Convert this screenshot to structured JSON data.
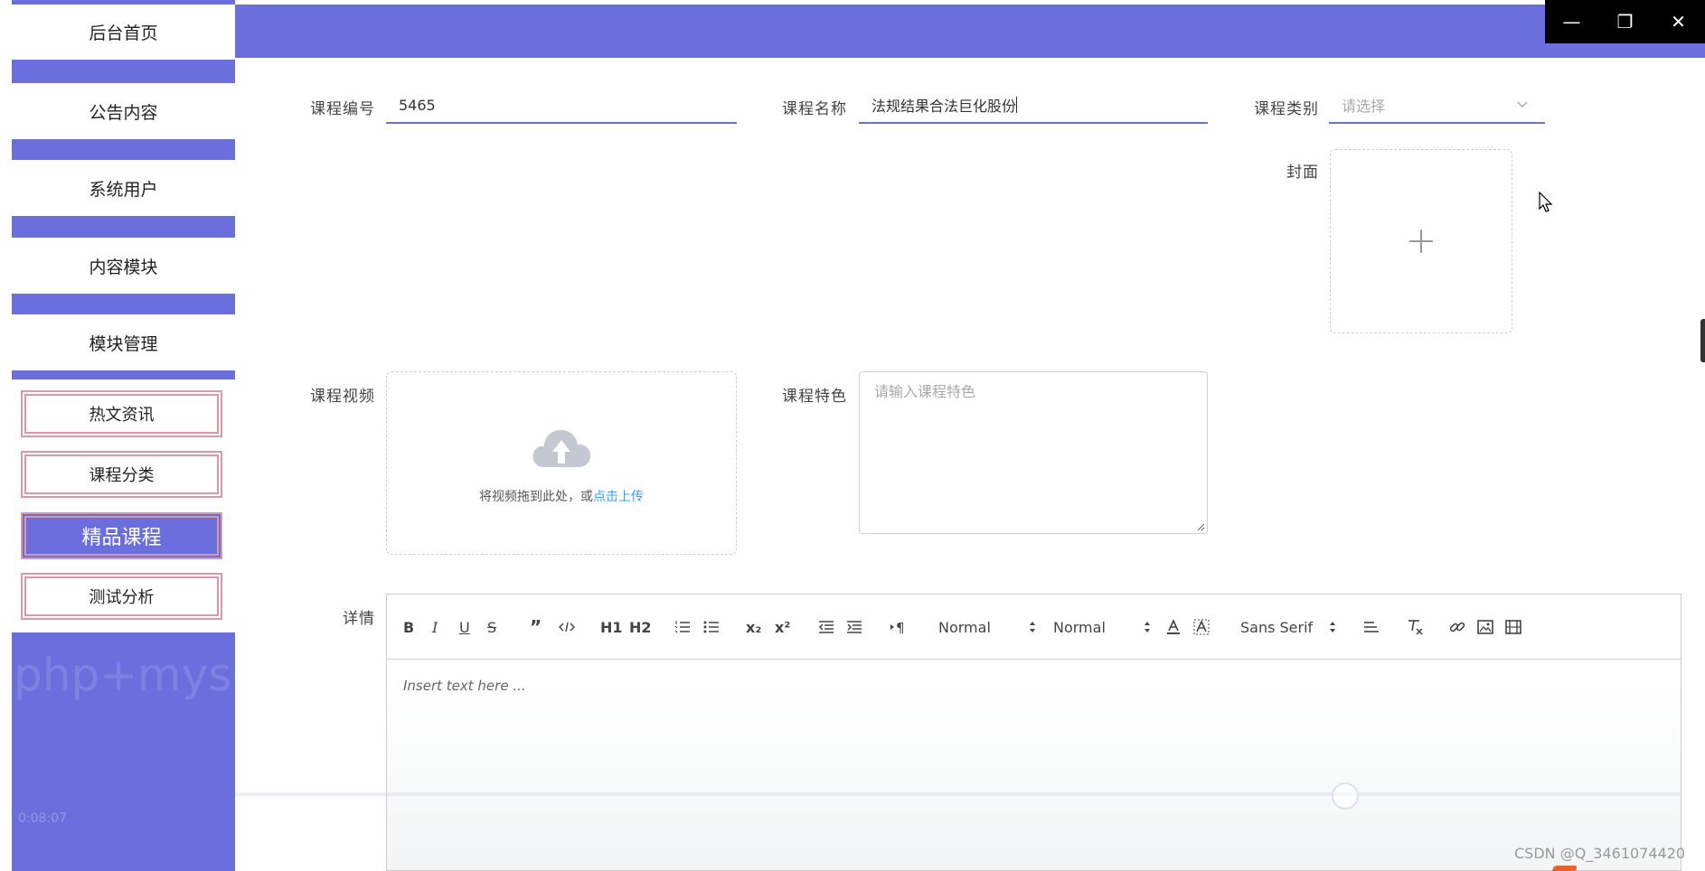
{
  "sidebar": {
    "main_items": [
      "后台首页",
      "公告内容",
      "系统用户",
      "内容模块",
      "模块管理"
    ],
    "sub_items": [
      "热文资讯",
      "课程分类",
      "精品课程",
      "测试分析"
    ],
    "active_sub": "精品课程",
    "overlay_text": "php+myso",
    "time": "0:08:07"
  },
  "form": {
    "course_no_label": "课程编号",
    "course_no_value": "5465",
    "course_name_label": "课程名称",
    "course_name_value": "法规结果合法巨化股份",
    "course_type_label": "课程类别",
    "course_type_placeholder": "请选择",
    "cover_label": "封面",
    "video_label": "课程视频",
    "video_drop_text": "将视频拖到此处，或",
    "video_upload_link": "点击上传",
    "feature_label": "课程特色",
    "feature_placeholder": "请输入课程特色",
    "detail_label": "详情"
  },
  "editor": {
    "toolbar": {
      "bold": "B",
      "italic": "I",
      "underline": "U",
      "strike": "S",
      "h1": "H1",
      "h2": "H2",
      "sub": "x₂",
      "sup": "x²",
      "size_select": "Normal",
      "header_select": "Normal",
      "font_select": "Sans Serif"
    },
    "placeholder": "Insert text here ..."
  },
  "watermark": "CSDN @Q_3461074420",
  "colors": {
    "accent": "#6b6fdd",
    "link": "#409eff"
  }
}
